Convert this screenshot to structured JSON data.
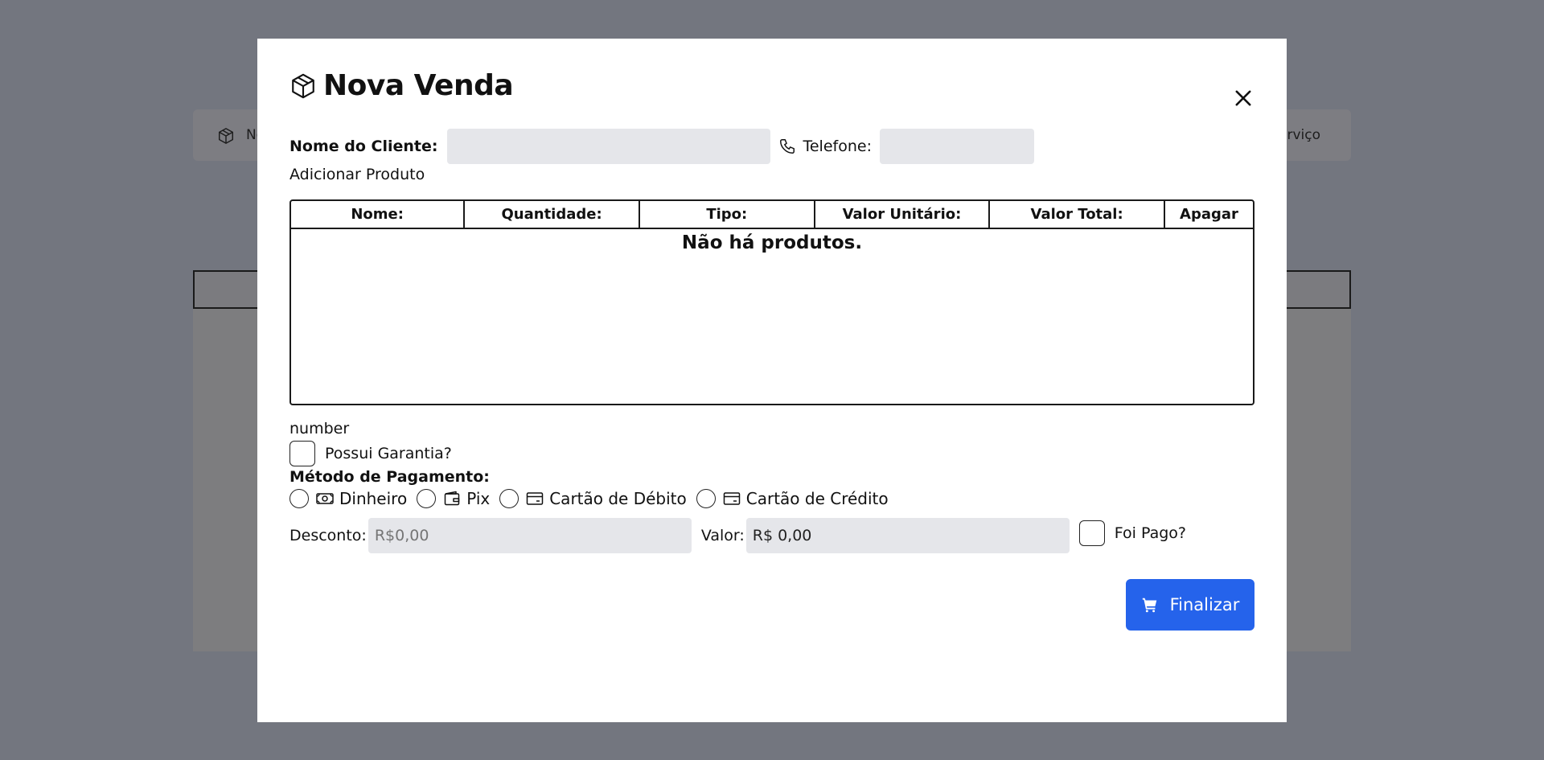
{
  "background": {
    "toolbar_left_label": "No",
    "toolbar_right_label": "Serviço"
  },
  "modal": {
    "title": "Nova Venda",
    "title_icon": "package-icon",
    "close_icon": "close-icon"
  },
  "client": {
    "name_label": "Nome do Cliente:",
    "name_value": "",
    "phone_label": "Telefone:",
    "phone_value": "",
    "phone_icon": "phone-icon"
  },
  "add_product_label": "Adicionar Produto",
  "products": {
    "columns": [
      "Nome:",
      "Quantidade:",
      "Tipo:",
      "Valor Unitário:",
      "Valor Total:",
      "Apagar"
    ],
    "rows": [],
    "empty_message": "Não há produtos."
  },
  "number_text": "number",
  "guarantee": {
    "label": "Possui Garantia?",
    "checked": false
  },
  "payment": {
    "title": "Método de Pagamento:",
    "options": [
      {
        "label": "Dinheiro",
        "icon": "cash-icon",
        "selected": false
      },
      {
        "label": "Pix",
        "icon": "wallet-icon",
        "selected": false
      },
      {
        "label": "Cartão de Débito",
        "icon": "credit-card-icon",
        "selected": false
      },
      {
        "label": "Cartão de Crédito",
        "icon": "credit-card-icon",
        "selected": false
      }
    ]
  },
  "values": {
    "discount_label": "Desconto:",
    "discount_placeholder": "R$0,00",
    "valor_label": "Valor:",
    "valor_value": "R$ 0,00",
    "paid_label": "Foi Pago?",
    "paid_checked": false
  },
  "finalize": {
    "label": "Finalizar",
    "icon": "cart-icon"
  },
  "colors": {
    "overlay": "#73767f",
    "input_bg": "#e5e6ea",
    "primary_button": "#2563eb"
  }
}
